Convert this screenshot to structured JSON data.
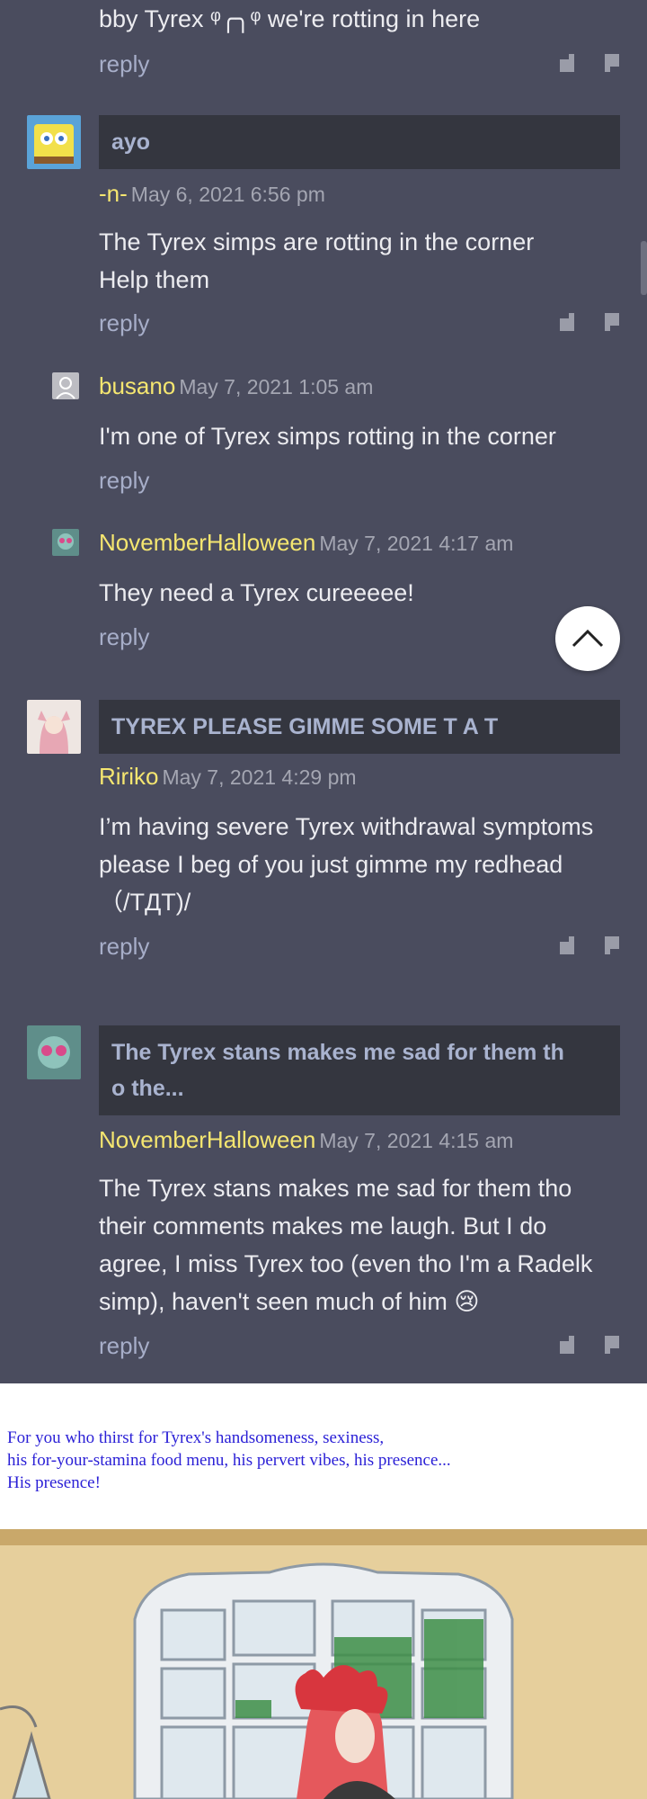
{
  "comments": [
    {
      "text": "bby Tyrex ᵠ╭╮ᵠ we're rotting in here",
      "reply": "reply"
    },
    {
      "title": "ayo",
      "author": "-n-",
      "date": "May 6, 2021 6:56 pm",
      "lines": [
        "The Tyrex simps are rotting in the corner",
        "Help them"
      ],
      "reply": "reply"
    },
    {
      "author": "busano",
      "date": "May 7, 2021 1:05 am",
      "text": "I'm one of Tyrex simps rotting in the corner",
      "reply": "reply"
    },
    {
      "author": "NovemberHalloween",
      "date": "May 7, 2021 4:17 am",
      "text": "They need a Tyrex cureeeee!",
      "reply": "reply"
    },
    {
      "title": "TYREX PLEASE GIMME SOME T A T",
      "author": "Ririko",
      "date": "May 7, 2021 4:29 pm",
      "lines": [
        "I’m having severe Tyrex withdrawal symptoms",
        "please I beg of you just gimme my redhead",
        "（/TДT)/"
      ],
      "reply": "reply"
    },
    {
      "title_lines": [
        "The Tyrex stans makes me sad for them th",
        "o the..."
      ],
      "author": "NovemberHalloween",
      "date": "May 7, 2021 4:15 am",
      "lines": [
        "The Tyrex stans makes me sad for them tho",
        "their comments makes me laugh. But I do",
        "agree, I miss Tyrex too (even tho I'm a Radelk",
        "simp), haven't seen much of him 😢"
      ],
      "reply": "reply"
    }
  ],
  "promo": {
    "lines": [
      "For you who thirst for Tyrex's handsomeness, sexiness,",
      "his for-your-stamina food menu, his pervert vibes, his presence...",
      "His presence!"
    ]
  },
  "colors": {
    "background": "#4a4c5e",
    "title_box": "#34363f",
    "author": "#f5e670",
    "reply": "#a7aec9",
    "promo_text": "#2a1fd6"
  },
  "icons": {
    "vote_up": "thumbs-up-icon",
    "vote_down": "thumbs-down-icon",
    "scroll_top": "chevron-up-icon"
  }
}
